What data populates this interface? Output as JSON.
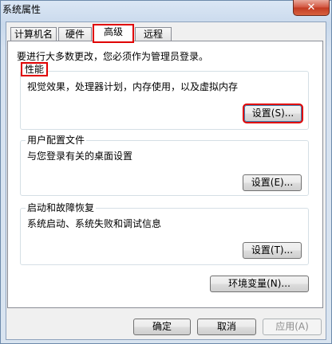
{
  "window": {
    "title": "系统属性",
    "close_glyph": "✕"
  },
  "tabs": [
    {
      "label": "计算机名",
      "active": false
    },
    {
      "label": "硬件",
      "active": false
    },
    {
      "label": "高级",
      "active": true
    },
    {
      "label": "远程",
      "active": false
    }
  ],
  "intro_text": "要进行大多数更改，您必须作为管理员登录。",
  "performance": {
    "title": "性能",
    "description": "视觉效果，处理器计划，内存使用，以及虚拟内存",
    "button_label": "设置(S)..."
  },
  "user_profiles": {
    "title": "用户配置文件",
    "description": "与您登录有关的桌面设置",
    "button_label": "设置(E)..."
  },
  "startup_recovery": {
    "title": "启动和故障恢复",
    "description": "系统启动、系统失败和调试信息",
    "button_label": "设置(T)..."
  },
  "env_button_label": "环境变量(N)...",
  "footer": {
    "ok_label": "确定",
    "cancel_label": "取消",
    "apply_label": "应用(A)"
  },
  "colors": {
    "highlight_box": "#e00000",
    "titlebar": "#c9d9ec",
    "close_button": "#c23a22"
  }
}
